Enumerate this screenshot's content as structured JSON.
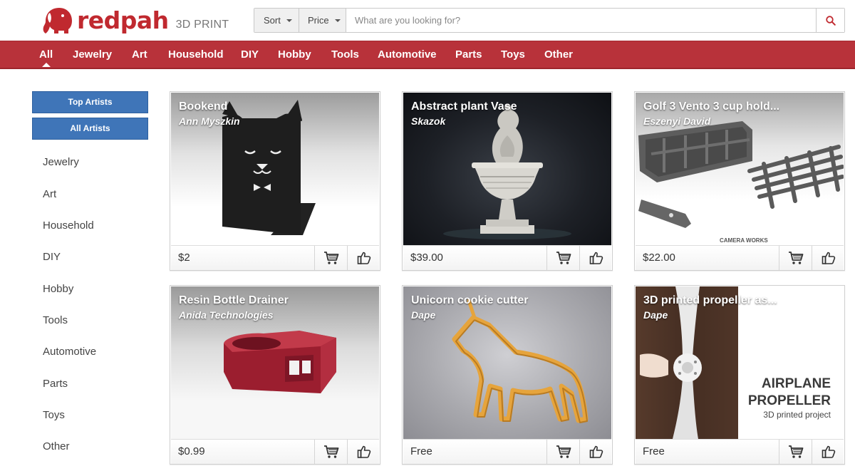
{
  "brand": {
    "name": "redpah",
    "subtitle": "3D PRINT",
    "color": "#c0292f"
  },
  "search": {
    "sort_label": "Sort",
    "price_label": "Price",
    "placeholder": "What are you looking for?",
    "button_icon": "search-icon"
  },
  "nav": {
    "active": "All",
    "items": [
      "All",
      "Jewelry",
      "Art",
      "Household",
      "DIY",
      "Hobby",
      "Tools",
      "Automotive",
      "Parts",
      "Toys",
      "Other"
    ],
    "color": "#b8323a"
  },
  "sidebar": {
    "buttons": [
      "Top Artists",
      "All Artists"
    ],
    "button_color": "#3f75b8",
    "categories": [
      "Jewelry",
      "Art",
      "Household",
      "DIY",
      "Hobby",
      "Tools",
      "Automotive",
      "Parts",
      "Toys",
      "Other"
    ]
  },
  "products": [
    {
      "title": "Bookend",
      "artist": "Ann Myszkin",
      "price": "$2",
      "image": "cat-bookend"
    },
    {
      "title": "Abstract plant Vase",
      "artist": "Skazok",
      "price": "$39.00",
      "image": "ornate-vase"
    },
    {
      "title": "Golf 3 Vento 3 cup hold...",
      "artist": "Eszenyi David",
      "price": "$22.00",
      "image": "cup-holder",
      "image_caption": "CAMERA WORKS"
    },
    {
      "title": "Resin Bottle Drainer",
      "artist": "Anida Technologies",
      "price": "$0.99",
      "image": "bottle-drainer"
    },
    {
      "title": "Unicorn cookie cutter",
      "artist": "Dape",
      "price": "Free",
      "image": "unicorn-cutter"
    },
    {
      "title": "3D printed propeller as...",
      "artist": "Dape",
      "price": "Free",
      "image": "propeller",
      "image_text": [
        "AIRPLANE",
        "PROPELLER",
        "3D printed project"
      ]
    }
  ],
  "card_actions": {
    "cart_icon": "cart-icon",
    "like_icon": "thumbs-up-icon"
  }
}
